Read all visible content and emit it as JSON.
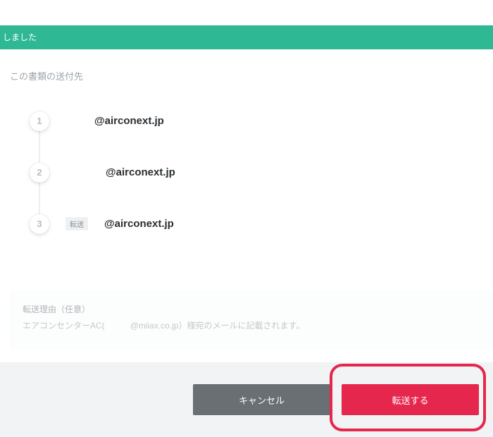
{
  "status_banner": "しました",
  "section_title": "この書類の送付先",
  "recipients": [
    {
      "step": "1",
      "badge": "",
      "email": "@airconext.jp"
    },
    {
      "step": "2",
      "badge": "",
      "email": "@airconext.jp"
    },
    {
      "step": "3",
      "badge": "転送",
      "email": "@airconext.jp"
    }
  ],
  "reason": {
    "label": "転送理由（任意）",
    "hint": "エアコンセンターAC(　　　@miiax.co.jp）様宛のメールに記載されます。"
  },
  "footer": {
    "cancel_label": "キャンセル",
    "submit_label": "転送する"
  },
  "colors": {
    "banner_bg": "#2fb894",
    "primary_button": "#e6274d",
    "cancel_button": "#696f73",
    "highlight_border": "#e6274d"
  }
}
